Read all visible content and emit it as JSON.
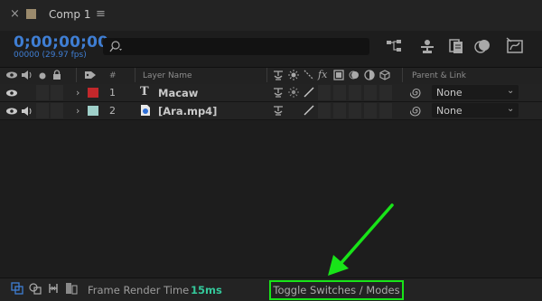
{
  "tab": {
    "close": "×",
    "title": "Comp 1",
    "menu": "≡"
  },
  "timecode": {
    "value": "0;00;00;00",
    "frames": "00000 (29.97 fps)"
  },
  "search": {
    "placeholder": "",
    "icon": "search-icon"
  },
  "header": {
    "number_label": "#",
    "layer_name_label": "Layer Name",
    "parent_link_label": "Parent & Link",
    "fx_label": "fx"
  },
  "layers": [
    {
      "number": "1",
      "type_icon": "T",
      "name": "Macaw",
      "label_color": "#c2282b",
      "parent": "None"
    },
    {
      "number": "2",
      "type_icon": "media-icon",
      "name": "[Ara.mp4]",
      "label_color": "#9fd0c9",
      "parent": "None"
    }
  ],
  "footer": {
    "render_label": "Frame Render Time",
    "render_value": "15ms",
    "toggle_label": "Toggle Switches / Modes"
  },
  "colors": {
    "accent": "#3f7ed3",
    "render_time": "#34c79a",
    "highlight": "#18e418"
  }
}
